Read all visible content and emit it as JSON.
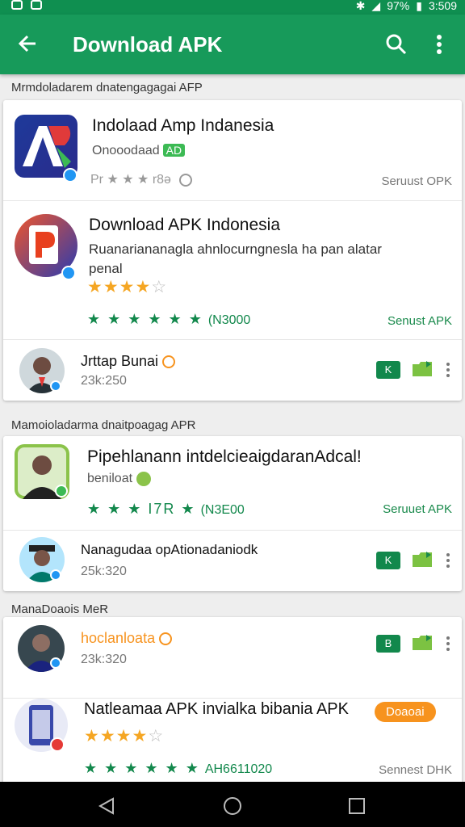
{
  "status": {
    "battery": "97%",
    "time": "3:509"
  },
  "appbar": {
    "title": "Download APK"
  },
  "sections": [
    {
      "title": "Mrmdoladarem dnatengagagai AFP",
      "items": [
        {
          "title": "Indolaad Amp Indanesia",
          "subtitle": "Onooodaad",
          "tag": "AD",
          "rating_text": "Pr ★ ★ ★ r8ə",
          "right": "Seruust OPK"
        },
        {
          "title": "Download APK Indonesia",
          "description": "Ruanariananagla ahnlocurngnesla ha pan alatar penal",
          "stars_on": 4,
          "stars_total": 5,
          "green_stars": "★ ★ ★ ★ ★ ★",
          "green_value": "(N3000",
          "right": "Senust APK"
        },
        {
          "title": "Jrttap Bunai",
          "subtitle": "23k:250",
          "action_label": "K"
        }
      ]
    },
    {
      "title": "Mamoioladarma dnaitpoagag APR",
      "items": [
        {
          "title": "Pipehlanann intdelcieaigdaranAdcal!",
          "subtitle": "beniloat",
          "green_stars": "★ ★ ★ I7R ★",
          "green_value": "(N3E00",
          "right": "Seruuet APK"
        },
        {
          "title": "Nanagudaa opAtionadaniodk",
          "subtitle": "25k:320",
          "action_label": "K"
        }
      ]
    },
    {
      "title": "ManaDoaois MeR",
      "items": [
        {
          "title": "hoclanloata",
          "subtitle": "23k:320",
          "action_label": "B"
        },
        {
          "title": "Natleamaa APK invialka bibania APK",
          "button": "Doaoai",
          "stars_on": 4,
          "stars_total": 5,
          "green_stars": "★ ★ ★ ★ ★ ★",
          "green_value": "AH6611020",
          "right": "Sennest DHK"
        }
      ]
    }
  ],
  "colors": {
    "primary": "#179a5a",
    "accent": "#12884c",
    "star": "#f5a623",
    "orange": "#f7931e"
  },
  "nav": {
    "back": "triangle-back-icon",
    "home": "circle-home-icon",
    "recents": "square-recents-icon"
  }
}
